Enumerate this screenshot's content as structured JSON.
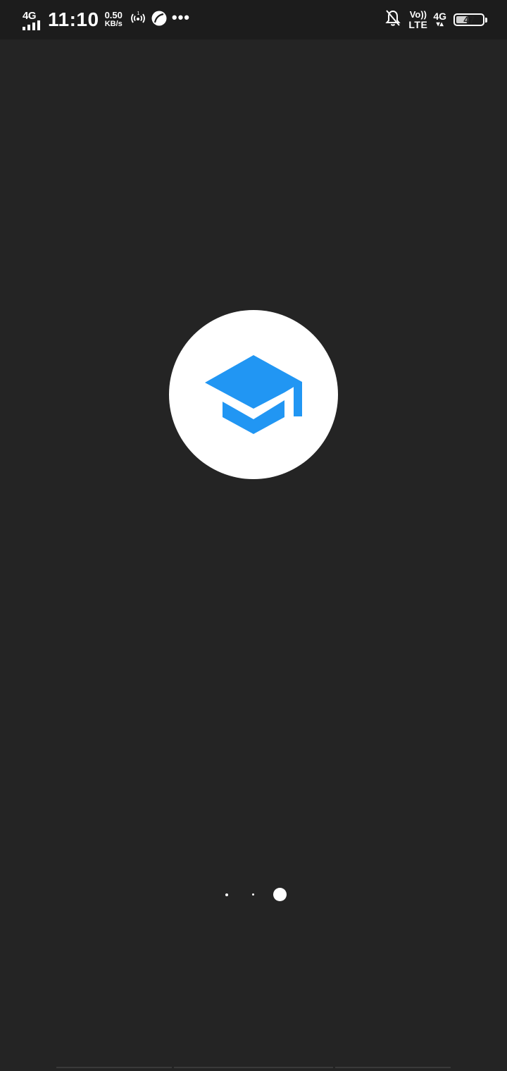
{
  "status_bar": {
    "network_type": "4G",
    "time": "11:10",
    "data_speed_value": "0.50",
    "data_speed_unit": "KB/s",
    "hotspot_label": "1",
    "volte_top": "Vo))",
    "volte_bottom": "LTE",
    "network_type_2": "4G",
    "battery_level": "47",
    "icons": [
      "signal-icon",
      "hotspot-icon",
      "leaf-app-icon",
      "more-notifications-icon",
      "bell-off-icon",
      "battery-icon"
    ]
  },
  "app": {
    "logo_icon": "graduation-cap-icon",
    "logo_color": "#2196F3",
    "background_color": "#242424"
  },
  "pager": {
    "page_count": 3,
    "active_page": 3
  }
}
